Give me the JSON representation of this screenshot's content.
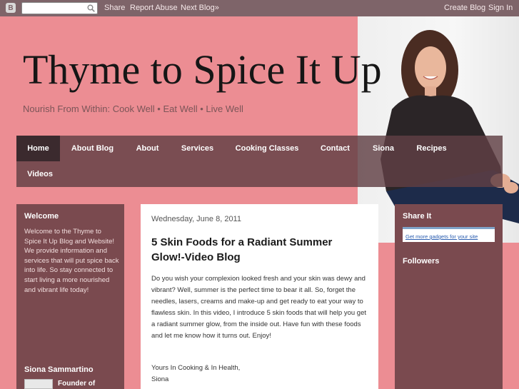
{
  "navbar": {
    "logo": "B",
    "share": "Share",
    "report_abuse": "Report Abuse",
    "next_blog": "Next Blog»",
    "create_blog": "Create Blog",
    "sign_in": "Sign In"
  },
  "header": {
    "title": "Thyme to Spice It Up",
    "description": "Nourish From Within: Cook Well • Eat Well • Live Well"
  },
  "tabs": [
    "Home",
    "About Blog",
    "About",
    "Services",
    "Cooking Classes",
    "Contact",
    "Siona",
    "Recipes",
    "Videos"
  ],
  "left_sidebar": {
    "welcome_title": "Welcome",
    "welcome_text": "Welcome to the Thyme to Spice It Up Blog and Website! We provide information and services that will put spice back into life. So stay connected to start living a more nourished and vibrant life today!",
    "profile_title": "Siona Sammartino",
    "profile_text": "Founder of"
  },
  "post": {
    "date": "Wednesday, June 8, 2011",
    "title": "5 Skin Foods for a Radiant Summer Glow!-Video Blog",
    "body": "Do you wish your complexion looked fresh and your skin was dewy and vibrant?  Well, summer is the perfect time to bear it all.  So, forget the needles, lasers, creams and make-up and get ready to eat your way to flawless skin.  In this video, I introduce 5 skin foods that will help you get a radiant summer glow, from the inside out. Have fun with  these foods and let me know how it turns out.  Enjoy!",
    "signoff": "Yours In Cooking & In Health,",
    "signature": "Siona"
  },
  "right_sidebar": {
    "share_title": "Share It",
    "gadget_link": "Get more gadgets for your site",
    "followers_title": "Followers"
  }
}
